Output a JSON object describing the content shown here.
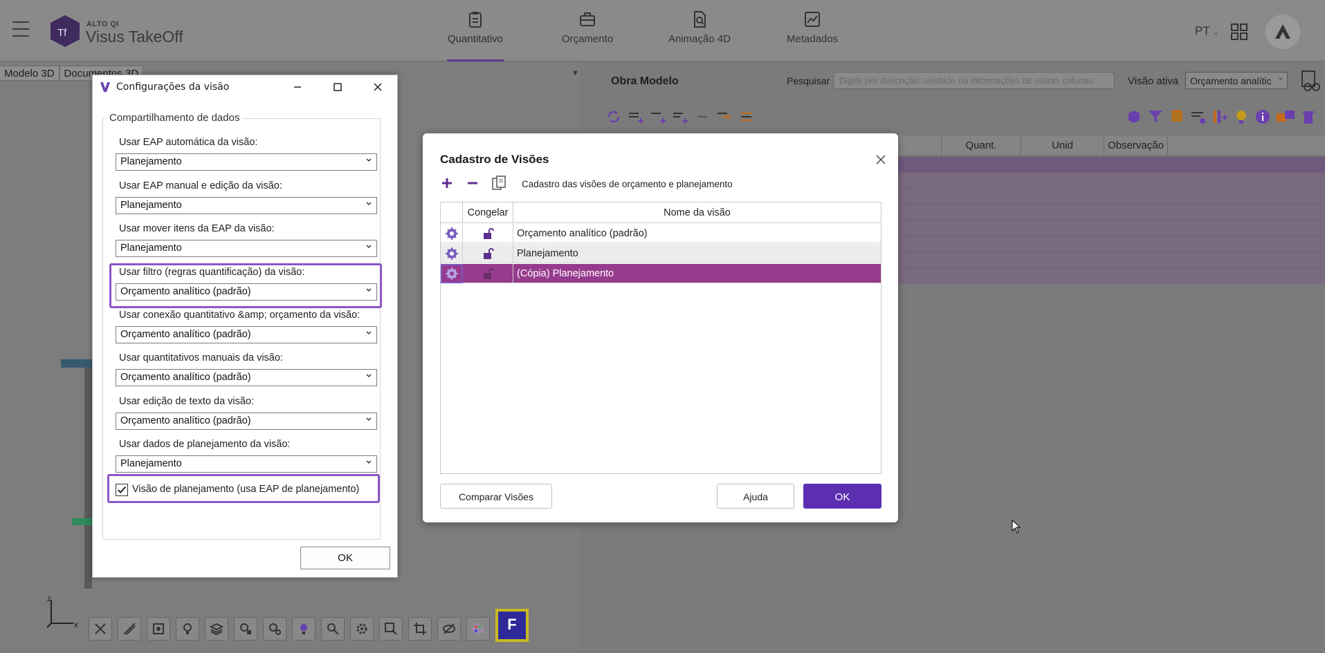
{
  "header": {
    "brand_small": "ALTO QI",
    "brand_name": "Visus TakeOff",
    "tabs": [
      {
        "label": "Quantitativo",
        "icon": "clipboard-icon",
        "active": true
      },
      {
        "label": "Orçamento",
        "icon": "briefcase-icon",
        "active": false
      },
      {
        "label": "Animação 4D",
        "icon": "document-search-icon",
        "active": false
      },
      {
        "label": "Metadados",
        "icon": "chart-icon",
        "active": false
      }
    ],
    "language": "PT"
  },
  "left_panel": {
    "doc_tabs": [
      "Modelo 3D",
      "Documentos 3D"
    ],
    "axis": {
      "z": "z",
      "x": "x"
    }
  },
  "right_panel": {
    "project_name": "Obra Modelo",
    "search_label": "Pesquisar",
    "search_placeholder": "Digite por descrição, unidade ou informações de outras colunas",
    "active_view_label": "Visão ativa",
    "active_view_value": "Orçamento analític",
    "grid_columns": [
      "Quant.",
      "Unid",
      "Observação"
    ]
  },
  "config_dialog": {
    "title": "Configurações da visão",
    "group_label": "Compartilhamento de dados",
    "fields": [
      {
        "label": "Usar EAP automática da visão:",
        "value": "Planejamento"
      },
      {
        "label": "Usar EAP manual e edição da visão:",
        "value": "Planejamento"
      },
      {
        "label": "Usar mover itens da EAP da visão:",
        "value": "Planejamento"
      },
      {
        "label": "Usar filtro (regras quantificação) da visão:",
        "value": "Orçamento analítico (padrão)"
      },
      {
        "label": "Usar conexão quantitativo &amp; orçamento da visão:",
        "value": "Orçamento analítico (padrão)"
      },
      {
        "label": "Usar quantitativos manuais da visão:",
        "value": "Orçamento analítico (padrão)"
      },
      {
        "label": "Usar edição de texto da visão:",
        "value": "Orçamento analítico (padrão)"
      },
      {
        "label": "Usar dados de planejamento da visão:",
        "value": "Planejamento"
      }
    ],
    "checkbox_label": "Visão de planejamento (usa EAP de planejamento)",
    "checkbox_checked": true,
    "ok_label": "OK"
  },
  "views_dialog": {
    "title": "Cadastro de Visões",
    "subtitle": "Cadastro das visões de orçamento e planejamento",
    "columns": {
      "freeze": "Congelar",
      "name": "Nome da visão"
    },
    "rows": [
      {
        "name": "Orçamento analítico (padrão)",
        "selected": false
      },
      {
        "name": "Planejamento",
        "selected": false
      },
      {
        "name": "(Cópia) Planejamento",
        "selected": true
      }
    ],
    "compare_label": "Comparar Visões",
    "help_label": "Ajuda",
    "ok_label": "OK"
  },
  "colors": {
    "accent": "#5b2fb0",
    "selected_row": "#963b8d",
    "highlight_box": "#8a56c7"
  }
}
